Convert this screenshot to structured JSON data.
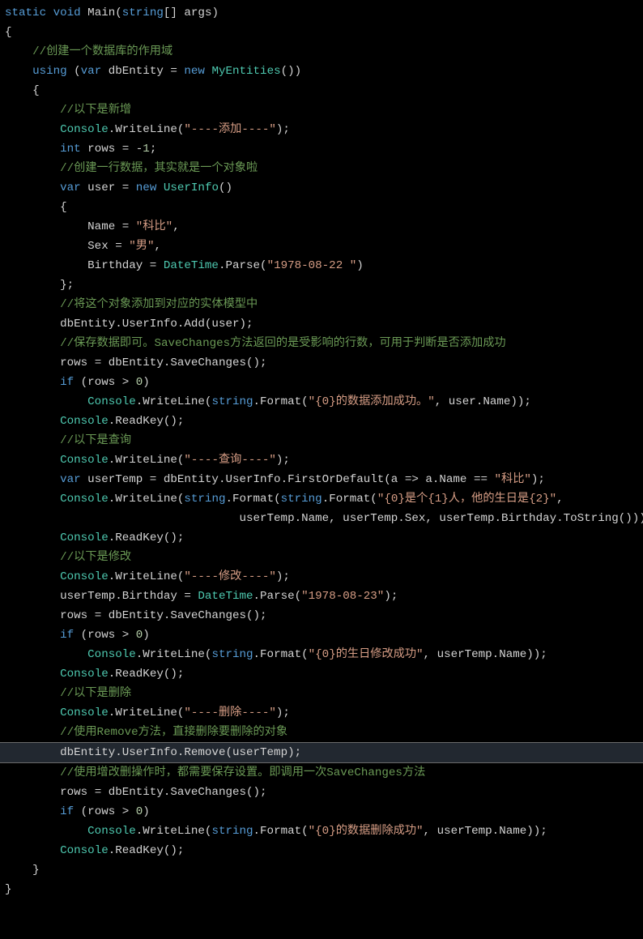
{
  "code": {
    "lines": [
      {
        "indent": 0,
        "segs": [
          {
            "c": "kw",
            "t": "static"
          },
          {
            "c": "id",
            "t": " "
          },
          {
            "c": "kw",
            "t": "void"
          },
          {
            "c": "id",
            "t": " Main("
          },
          {
            "c": "kw",
            "t": "string"
          },
          {
            "c": "id",
            "t": "[] args)"
          }
        ]
      },
      {
        "indent": 0,
        "segs": [
          {
            "c": "id",
            "t": "{"
          }
        ]
      },
      {
        "indent": 1,
        "segs": [
          {
            "c": "cm",
            "t": "//创建一个数据库的作用域"
          }
        ]
      },
      {
        "indent": 1,
        "segs": [
          {
            "c": "kw",
            "t": "using"
          },
          {
            "c": "id",
            "t": " ("
          },
          {
            "c": "kw",
            "t": "var"
          },
          {
            "c": "id",
            "t": " dbEntity = "
          },
          {
            "c": "kw",
            "t": "new"
          },
          {
            "c": "id",
            "t": " "
          },
          {
            "c": "type",
            "t": "MyEntities"
          },
          {
            "c": "id",
            "t": "())"
          }
        ]
      },
      {
        "indent": 1,
        "segs": [
          {
            "c": "id",
            "t": "{"
          }
        ]
      },
      {
        "indent": 2,
        "segs": [
          {
            "c": "cm",
            "t": "//以下是新增"
          }
        ]
      },
      {
        "indent": 2,
        "segs": [
          {
            "c": "type",
            "t": "Console"
          },
          {
            "c": "id",
            "t": ".WriteLine("
          },
          {
            "c": "str",
            "t": "\"----添加----\""
          },
          {
            "c": "id",
            "t": ");"
          }
        ]
      },
      {
        "indent": 2,
        "segs": [
          {
            "c": "kw",
            "t": "int"
          },
          {
            "c": "id",
            "t": " rows = -"
          },
          {
            "c": "num",
            "t": "1"
          },
          {
            "c": "id",
            "t": ";"
          }
        ]
      },
      {
        "indent": 2,
        "segs": [
          {
            "c": "cm",
            "t": "//创建一行数据，其实就是一个对象啦"
          }
        ]
      },
      {
        "indent": 2,
        "segs": [
          {
            "c": "kw",
            "t": "var"
          },
          {
            "c": "id",
            "t": " user = "
          },
          {
            "c": "kw",
            "t": "new"
          },
          {
            "c": "id",
            "t": " "
          },
          {
            "c": "type",
            "t": "UserInfo"
          },
          {
            "c": "id",
            "t": "()"
          }
        ]
      },
      {
        "indent": 2,
        "segs": [
          {
            "c": "id",
            "t": "{"
          }
        ]
      },
      {
        "indent": 3,
        "segs": [
          {
            "c": "id",
            "t": "Name = "
          },
          {
            "c": "str",
            "t": "\"科比\""
          },
          {
            "c": "id",
            "t": ","
          }
        ]
      },
      {
        "indent": 3,
        "segs": [
          {
            "c": "id",
            "t": "Sex = "
          },
          {
            "c": "str",
            "t": "\"男\""
          },
          {
            "c": "id",
            "t": ","
          }
        ]
      },
      {
        "indent": 3,
        "segs": [
          {
            "c": "id",
            "t": "Birthday = "
          },
          {
            "c": "type",
            "t": "DateTime"
          },
          {
            "c": "id",
            "t": ".Parse("
          },
          {
            "c": "str",
            "t": "\"1978-08-22 \""
          },
          {
            "c": "id",
            "t": ")"
          }
        ]
      },
      {
        "indent": 2,
        "segs": [
          {
            "c": "id",
            "t": "};"
          }
        ]
      },
      {
        "indent": 2,
        "segs": [
          {
            "c": "cm",
            "t": "//将这个对象添加到对应的实体模型中"
          }
        ]
      },
      {
        "indent": 2,
        "segs": [
          {
            "c": "id",
            "t": "dbEntity.UserInfo.Add(user);"
          }
        ]
      },
      {
        "indent": 2,
        "segs": [
          {
            "c": "cm",
            "t": "//保存数据即可。SaveChanges方法返回的是受影响的行数，可用于判断是否添加成功"
          }
        ]
      },
      {
        "indent": 2,
        "segs": [
          {
            "c": "id",
            "t": "rows = dbEntity.SaveChanges();"
          }
        ]
      },
      {
        "indent": 2,
        "segs": [
          {
            "c": "kw",
            "t": "if"
          },
          {
            "c": "id",
            "t": " (rows > "
          },
          {
            "c": "num",
            "t": "0"
          },
          {
            "c": "id",
            "t": ")"
          }
        ]
      },
      {
        "indent": 3,
        "segs": [
          {
            "c": "type",
            "t": "Console"
          },
          {
            "c": "id",
            "t": ".WriteLine("
          },
          {
            "c": "kw",
            "t": "string"
          },
          {
            "c": "id",
            "t": ".Format("
          },
          {
            "c": "str",
            "t": "\"{0}的数据添加成功。\""
          },
          {
            "c": "id",
            "t": ", user.Name));"
          }
        ]
      },
      {
        "indent": 2,
        "segs": [
          {
            "c": "type",
            "t": "Console"
          },
          {
            "c": "id",
            "t": ".ReadKey();"
          }
        ]
      },
      {
        "indent": 2,
        "segs": [
          {
            "c": "cm",
            "t": "//以下是查询"
          }
        ]
      },
      {
        "indent": 2,
        "segs": [
          {
            "c": "type",
            "t": "Console"
          },
          {
            "c": "id",
            "t": ".WriteLine("
          },
          {
            "c": "str",
            "t": "\"----查询----\""
          },
          {
            "c": "id",
            "t": ");"
          }
        ]
      },
      {
        "indent": 2,
        "segs": [
          {
            "c": "kw",
            "t": "var"
          },
          {
            "c": "id",
            "t": " userTemp = dbEntity.UserInfo.FirstOrDefault(a => a.Name == "
          },
          {
            "c": "str",
            "t": "\"科比\""
          },
          {
            "c": "id",
            "t": ");"
          }
        ]
      },
      {
        "indent": 2,
        "segs": [
          {
            "c": "type",
            "t": "Console"
          },
          {
            "c": "id",
            "t": ".WriteLine("
          },
          {
            "c": "kw",
            "t": "string"
          },
          {
            "c": "id",
            "t": ".Format("
          },
          {
            "c": "kw",
            "t": "string"
          },
          {
            "c": "id",
            "t": ".Format("
          },
          {
            "c": "str",
            "t": "\"{0}是个{1}人，他的生日是{2}\""
          },
          {
            "c": "id",
            "t": ","
          }
        ]
      },
      {
        "indent": 0,
        "segs": [
          {
            "c": "id",
            "t": "                                  userTemp.Name, userTemp.Sex, userTemp.Birthday.ToString())));"
          }
        ]
      },
      {
        "indent": 2,
        "segs": [
          {
            "c": "type",
            "t": "Console"
          },
          {
            "c": "id",
            "t": ".ReadKey();"
          }
        ]
      },
      {
        "indent": 2,
        "segs": [
          {
            "c": "cm",
            "t": "//以下是修改"
          }
        ]
      },
      {
        "indent": 2,
        "segs": [
          {
            "c": "type",
            "t": "Console"
          },
          {
            "c": "id",
            "t": ".WriteLine("
          },
          {
            "c": "str",
            "t": "\"----修改----\""
          },
          {
            "c": "id",
            "t": ");"
          }
        ]
      },
      {
        "indent": 2,
        "segs": [
          {
            "c": "id",
            "t": "userTemp.Birthday = "
          },
          {
            "c": "type",
            "t": "DateTime"
          },
          {
            "c": "id",
            "t": ".Parse("
          },
          {
            "c": "str",
            "t": "\"1978-08-23\""
          },
          {
            "c": "id",
            "t": ");"
          }
        ]
      },
      {
        "indent": 2,
        "segs": [
          {
            "c": "id",
            "t": "rows = dbEntity.SaveChanges();"
          }
        ]
      },
      {
        "indent": 2,
        "segs": [
          {
            "c": "kw",
            "t": "if"
          },
          {
            "c": "id",
            "t": " (rows > "
          },
          {
            "c": "num",
            "t": "0"
          },
          {
            "c": "id",
            "t": ")"
          }
        ]
      },
      {
        "indent": 3,
        "segs": [
          {
            "c": "type",
            "t": "Console"
          },
          {
            "c": "id",
            "t": ".WriteLine("
          },
          {
            "c": "kw",
            "t": "string"
          },
          {
            "c": "id",
            "t": ".Format("
          },
          {
            "c": "str",
            "t": "\"{0}的生日修改成功\""
          },
          {
            "c": "id",
            "t": ", userTemp.Name));"
          }
        ]
      },
      {
        "indent": 2,
        "segs": [
          {
            "c": "type",
            "t": "Console"
          },
          {
            "c": "id",
            "t": ".ReadKey();"
          }
        ]
      },
      {
        "indent": 2,
        "segs": [
          {
            "c": "cm",
            "t": "//以下是删除"
          }
        ]
      },
      {
        "indent": 2,
        "segs": [
          {
            "c": "type",
            "t": "Console"
          },
          {
            "c": "id",
            "t": ".WriteLine("
          },
          {
            "c": "str",
            "t": "\"----删除----\""
          },
          {
            "c": "id",
            "t": ");"
          }
        ]
      },
      {
        "indent": 2,
        "segs": [
          {
            "c": "cm",
            "t": "//使用Remove方法，直接删除要删除的对象"
          }
        ]
      },
      {
        "indent": 2,
        "highlight": true,
        "segs": [
          {
            "c": "id",
            "t": "dbEntity.UserInfo.Remove(userTemp);"
          }
        ]
      },
      {
        "indent": 2,
        "segs": [
          {
            "c": "cm",
            "t": "//使用增改删操作时，都需要保存设置。即调用一次SaveChanges方法"
          }
        ]
      },
      {
        "indent": 2,
        "segs": [
          {
            "c": "id",
            "t": "rows = dbEntity.SaveChanges();"
          }
        ]
      },
      {
        "indent": 2,
        "segs": [
          {
            "c": "kw",
            "t": "if"
          },
          {
            "c": "id",
            "t": " (rows > "
          },
          {
            "c": "num",
            "t": "0"
          },
          {
            "c": "id",
            "t": ")"
          }
        ]
      },
      {
        "indent": 3,
        "segs": [
          {
            "c": "type",
            "t": "Console"
          },
          {
            "c": "id",
            "t": ".WriteLine("
          },
          {
            "c": "kw",
            "t": "string"
          },
          {
            "c": "id",
            "t": ".Format("
          },
          {
            "c": "str",
            "t": "\"{0}的数据删除成功\""
          },
          {
            "c": "id",
            "t": ", userTemp.Name));"
          }
        ]
      },
      {
        "indent": 2,
        "segs": [
          {
            "c": "type",
            "t": "Console"
          },
          {
            "c": "id",
            "t": ".ReadKey();"
          }
        ]
      },
      {
        "indent": 1,
        "segs": [
          {
            "c": "id",
            "t": "}"
          }
        ]
      },
      {
        "indent": 0,
        "segs": [
          {
            "c": "id",
            "t": "}"
          }
        ]
      }
    ],
    "indent_unit": "    "
  }
}
